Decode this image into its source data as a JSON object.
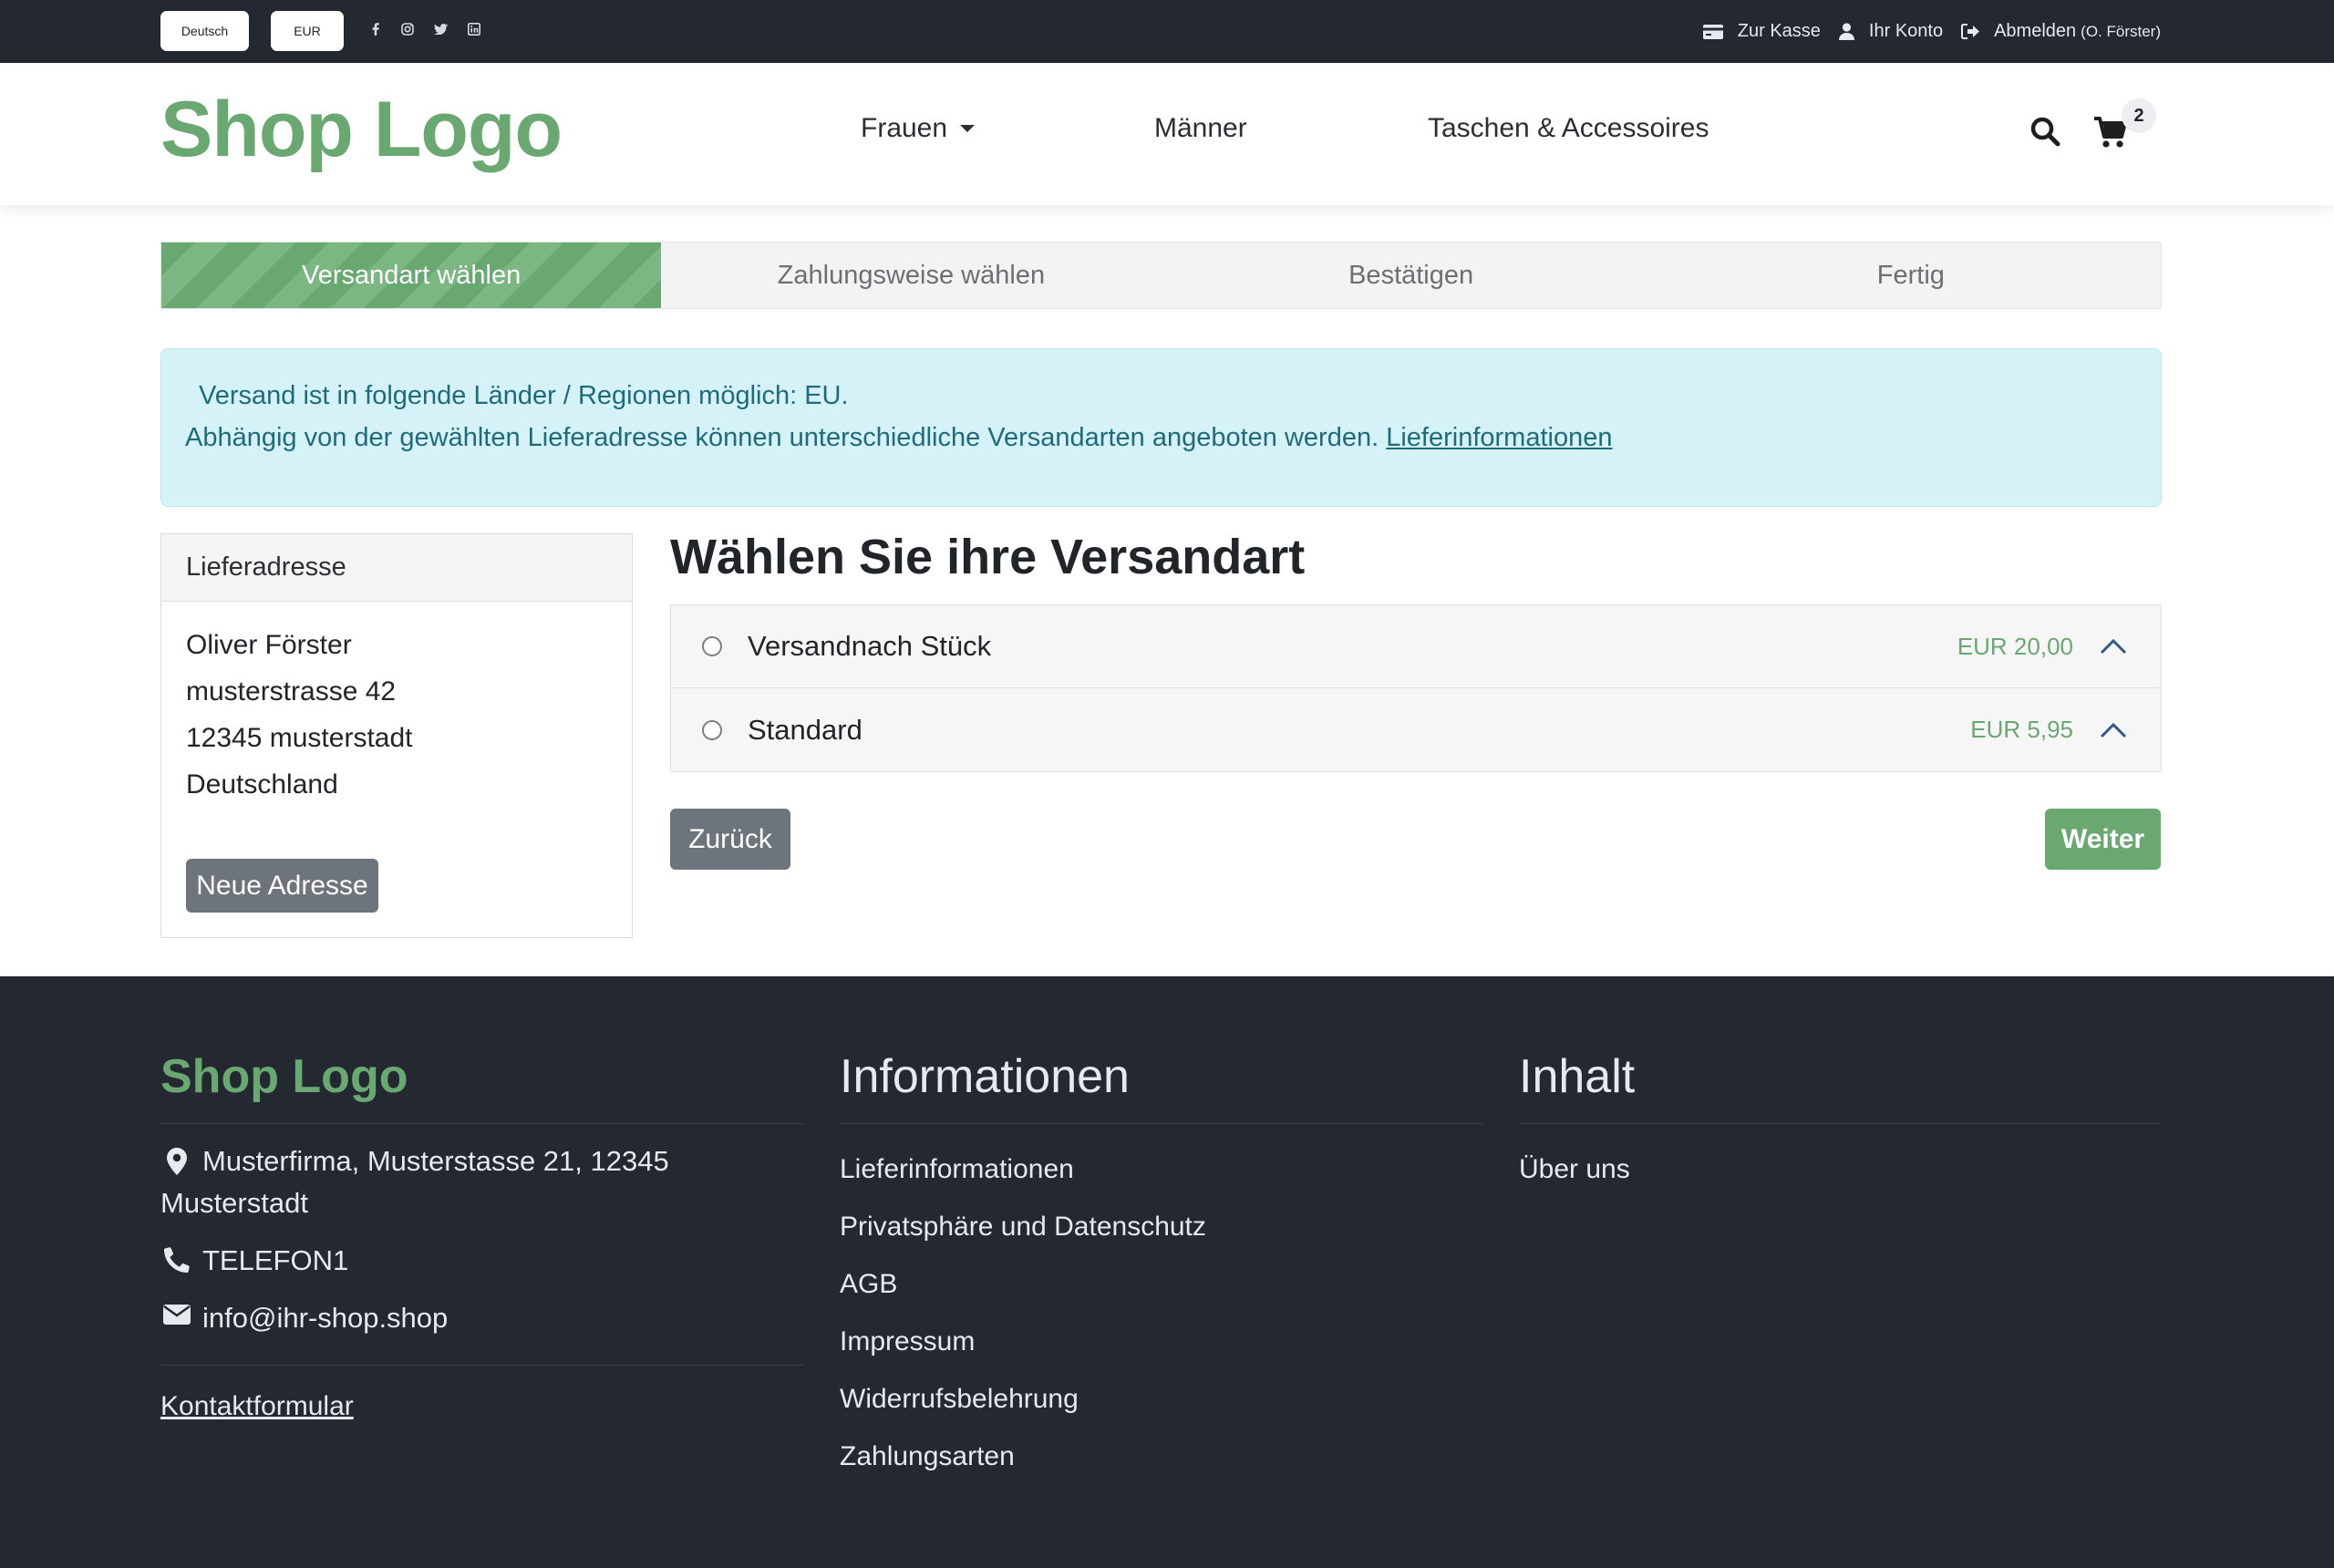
{
  "topbar": {
    "language": "Deutsch",
    "currency": "EUR",
    "social_icons": [
      "facebook-icon",
      "instagram-icon",
      "twitter-icon",
      "linkedin-icon"
    ],
    "links": {
      "checkout": "Zur Kasse",
      "account": "Ihr Konto",
      "logout": "Abmelden",
      "logout_user": "(O. Förster)"
    }
  },
  "header": {
    "logo": "Shop Logo",
    "nav": [
      "Frauen",
      "Männer",
      "Taschen & Accessoires"
    ],
    "cart_count": "2"
  },
  "steps": [
    "Versandart wählen",
    "Zahlungsweise wählen",
    "Bestätigen",
    "Fertig"
  ],
  "alert": {
    "line1": "Versand ist in folgende Länder / Regionen möglich: EU.",
    "line2": "Abhängig von der gewählten Lieferadresse können unterschiedliche Versandarten angeboten werden.",
    "link": "Lieferinformationen"
  },
  "address": {
    "title": "Lieferadresse",
    "name": "Oliver Förster",
    "street": "musterstrasse 42",
    "city": "12345 musterstadt",
    "country": "Deutschland",
    "new_button": "Neue Adresse"
  },
  "shipping": {
    "title": "Wählen Sie ihre Versandart",
    "options": [
      {
        "name": "Versandnach Stück",
        "price": "EUR 20,00"
      },
      {
        "name": "Standard",
        "price": "EUR 5,95"
      }
    ],
    "back_button": "Zurück",
    "next_button": "Weiter"
  },
  "footer": {
    "logo": "Shop Logo",
    "address_line1": "Musterfirma, Musterstasse 21, 12345",
    "address_line2": "Musterstadt",
    "phone": "TELEFON1",
    "email": "info@ihr-shop.shop",
    "contact_form": " Kontaktformular",
    "info_title": "Informationen",
    "info_links": [
      "Lieferinformationen",
      "Privatsphäre und Datenschutz",
      "AGB",
      "Impressum",
      "Widerrufsbelehrung",
      "Zahlungsarten"
    ],
    "content_title": "Inhalt",
    "content_links": [
      "Über uns"
    ]
  },
  "colors": {
    "brand_green": "#6aa872",
    "dark_bg": "#232831",
    "alert_bg": "#d5f2f9",
    "alert_text": "#1f6b7b",
    "secondary_button": "#6e747b"
  }
}
